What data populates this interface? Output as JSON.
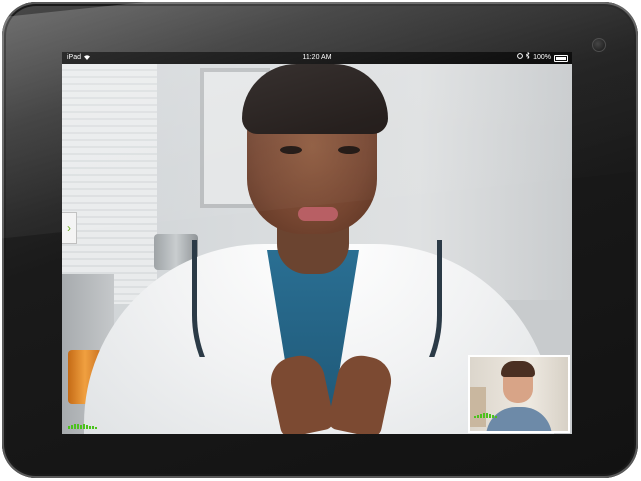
{
  "status_bar": {
    "device": "iPad",
    "time": "11:20 AM",
    "battery": "100%",
    "icons": [
      "wifi-icon",
      "lock-rotation-icon",
      "bluetooth-icon",
      "battery-icon"
    ]
  },
  "call": {
    "remote_participant": "doctor",
    "self_view": "patient",
    "collapse_button_glyph": "›",
    "accent_color": "#4cc21d"
  }
}
